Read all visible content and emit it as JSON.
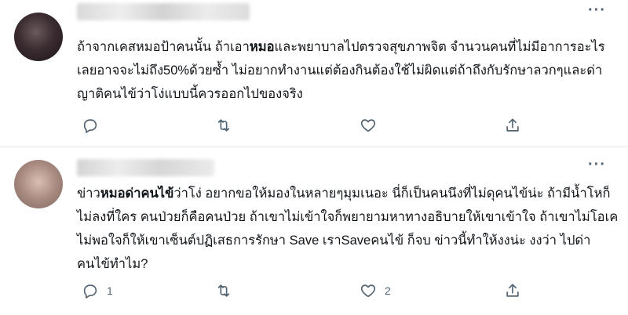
{
  "posts": [
    {
      "text_parts": [
        {
          "t": "ถ้าจากเคสหมอป้าคนนั้น ถ้าเอา",
          "bold": false
        },
        {
          "t": "หมอ",
          "bold": true
        },
        {
          "t": "และพยาบาลไปตรวจสุขภาพจิต จำนวนคนที่ไม่มีอาการอะไรเลยอาจจะไม่ถึง50%ด้วยซ้ำ ไม่อยากทำงานแต่ต้องกินต้องใช้ไม่ผิดแต่ถ้าถึงกับรักษาลวกๆและด่าญาติคนไข้ว่าโง่แบบนี้ควรออกไปของจริง",
          "bold": false
        }
      ],
      "more_label": "···",
      "actions": {
        "reply_count": "",
        "retweet_count": "",
        "like_count": ""
      },
      "icons": [
        "reply-icon",
        "retweet-icon",
        "like-icon",
        "share-icon"
      ]
    },
    {
      "text_parts": [
        {
          "t": "ข่าว",
          "bold": false
        },
        {
          "t": "หมอด่าคนไข้",
          "bold": true
        },
        {
          "t": "ว่าโง่ อยากขอให้มองในหลายๆมุมเนอะ นี่ก็เป็นคนนึงที่ไม่ดุคนไข้น่ะ ถ้ามีน้ำโหก็ไม่ลงที่ใคร คนป่วยก็คือคนป่วย ถ้าเขาไม่เข้าใจก็พยายามหาทางอธิบายให้เขาเข้าใจ ถ้าเขาไม่โอเคไม่พอใจก็ให้เขาเซ็นต์ปฏิเสธการรักษา Save เราSaveคนไข้ ก็จบ ข่าวนี้ทำให้งงน่ะ งงว่า ไปด่าคนไข้ทำไม?",
          "bold": false
        }
      ],
      "more_label": "···",
      "actions": {
        "reply_count": "1",
        "retweet_count": "",
        "like_count": "2"
      },
      "icons": [
        "reply-icon",
        "retweet-icon",
        "like-icon",
        "share-icon"
      ]
    }
  ],
  "colors": {
    "text": "#0f1419",
    "muted": "#536471",
    "divider": "#e5e8eb"
  }
}
